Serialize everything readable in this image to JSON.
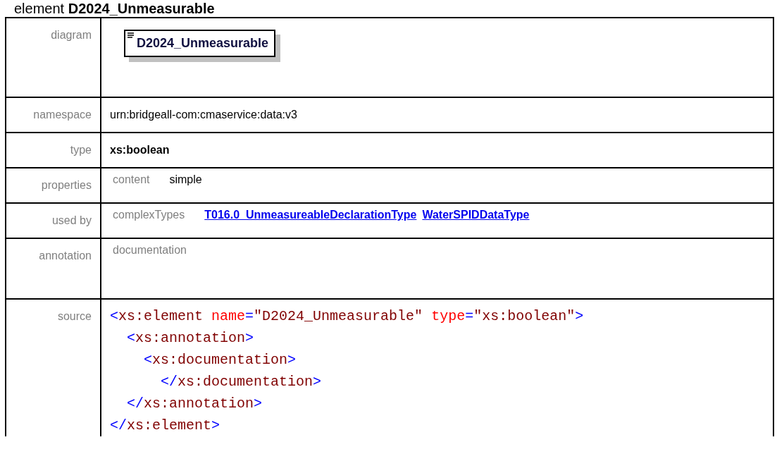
{
  "title": "element **D2024_Unmeasurable**",
  "rows": [
    {
      "kind": "diagram",
      "label": "diagram",
      "element_name": "D2024_Unmeasurable"
    },
    {
      "kind": "text",
      "label": "namespace",
      "value": "urn:bridgeall-com:cmaservice:data:v3"
    },
    {
      "kind": "bold",
      "label": "type",
      "value": "xs:boolean"
    },
    {
      "kind": "pair",
      "label": "properties",
      "key": "content",
      "values": [
        {
          "text": "simple",
          "link": false
        }
      ]
    },
    {
      "kind": "pair",
      "label": "used by",
      "key": "complexTypes",
      "values": [
        {
          "text": "T016.0_UnmeasureableDeclarationType",
          "link": true
        },
        {
          "text": "WaterSPIDDataType",
          "link": true
        }
      ]
    },
    {
      "kind": "pair",
      "label": "annotation",
      "key": "documentation"
    },
    {
      "kind": "code",
      "label": "source",
      "lines": [
        [
          {
            "kind": "punct",
            "text": "<"
          },
          {
            "kind": "tag",
            "text": "xs:element "
          },
          {
            "kind": "attr",
            "text": "name"
          },
          {
            "kind": "punct",
            "text": "="
          },
          {
            "kind": "value",
            "text": "\"D2024_Unmeasurable\" "
          },
          {
            "kind": "attr",
            "text": "type"
          },
          {
            "kind": "punct",
            "text": "="
          },
          {
            "kind": "value",
            "text": "\"xs:boolean\""
          },
          {
            "kind": "punct",
            "text": ">"
          }
        ],
        [
          {
            "kind": "punct",
            "text": "  <"
          },
          {
            "kind": "tag",
            "text": "xs:annotation"
          },
          {
            "kind": "punct",
            "text": ">"
          }
        ],
        [
          {
            "kind": "punct",
            "text": "    <"
          },
          {
            "kind": "tag",
            "text": "xs:documentation"
          },
          {
            "kind": "punct",
            "text": ">"
          }
        ],
        [
          {
            "kind": "punct",
            "text": "      </"
          },
          {
            "kind": "tag",
            "text": "xs:documentation"
          },
          {
            "kind": "punct",
            "text": ">"
          }
        ],
        [
          {
            "kind": "punct",
            "text": "  </"
          },
          {
            "kind": "tag",
            "text": "xs:annotation"
          },
          {
            "kind": "punct",
            "text": ">"
          }
        ],
        [
          {
            "kind": "punct",
            "text": "</"
          },
          {
            "kind": "tag",
            "text": "xs:element"
          },
          {
            "kind": "punct",
            "text": ">"
          }
        ]
      ]
    }
  ]
}
